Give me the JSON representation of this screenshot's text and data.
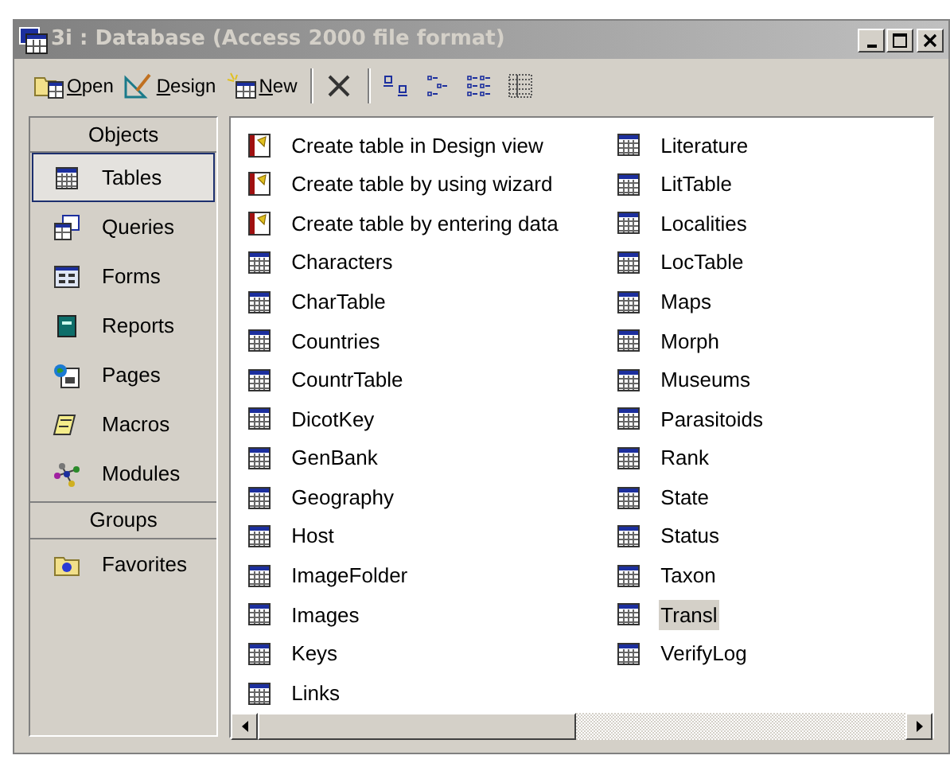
{
  "window": {
    "title": "3i : Database (Access 2000 file format)"
  },
  "toolbar": {
    "buttons": [
      {
        "label": "Open",
        "kind": "open"
      },
      {
        "label": "Design",
        "kind": "design"
      },
      {
        "label": "New",
        "kind": "new"
      }
    ],
    "tools": [
      {
        "kind": "delete"
      },
      {
        "kind": "large"
      },
      {
        "kind": "small"
      },
      {
        "kind": "list"
      },
      {
        "kind": "details"
      }
    ]
  },
  "sidebar": {
    "objects_header": "Objects",
    "items": [
      {
        "label": "Tables",
        "kind": "tables",
        "selected": true
      },
      {
        "label": "Queries",
        "kind": "queries",
        "selected": false
      },
      {
        "label": "Forms",
        "kind": "forms",
        "selected": false
      },
      {
        "label": "Reports",
        "kind": "reports",
        "selected": false
      },
      {
        "label": "Pages",
        "kind": "pages",
        "selected": false
      },
      {
        "label": "Macros",
        "kind": "macros",
        "selected": false
      },
      {
        "label": "Modules",
        "kind": "modules",
        "selected": false
      }
    ],
    "groups_header": "Groups",
    "groups": [
      {
        "label": "Favorites",
        "selected": false
      }
    ]
  },
  "list": {
    "columns": [
      [
        {
          "label": "Create table in Design view",
          "kind": "wizard",
          "selected": false
        },
        {
          "label": "Create table by using wizard",
          "kind": "wizard",
          "selected": false
        },
        {
          "label": "Create table by entering data",
          "kind": "wizard",
          "selected": false
        },
        {
          "label": "Characters",
          "kind": "table",
          "selected": false
        },
        {
          "label": "CharTable",
          "kind": "table",
          "selected": false
        },
        {
          "label": "Countries",
          "kind": "table",
          "selected": false
        },
        {
          "label": "CountrTable",
          "kind": "table",
          "selected": false
        },
        {
          "label": "DicotKey",
          "kind": "table",
          "selected": false
        },
        {
          "label": "GenBank",
          "kind": "table",
          "selected": false
        },
        {
          "label": "Geography",
          "kind": "table",
          "selected": false
        },
        {
          "label": "Host",
          "kind": "table",
          "selected": false
        },
        {
          "label": "ImageFolder",
          "kind": "table",
          "selected": false
        },
        {
          "label": "Images",
          "kind": "table",
          "selected": false
        },
        {
          "label": "Keys",
          "kind": "table",
          "selected": false
        },
        {
          "label": "Links",
          "kind": "table",
          "selected": false
        }
      ],
      [
        {
          "label": "Literature",
          "kind": "table",
          "selected": false
        },
        {
          "label": "LitTable",
          "kind": "table",
          "selected": false
        },
        {
          "label": "Localities",
          "kind": "table",
          "selected": false
        },
        {
          "label": "LocTable",
          "kind": "table",
          "selected": false
        },
        {
          "label": "Maps",
          "kind": "table",
          "selected": false
        },
        {
          "label": "Morph",
          "kind": "table",
          "selected": false
        },
        {
          "label": "Museums",
          "kind": "table",
          "selected": false
        },
        {
          "label": "Parasitoids",
          "kind": "table",
          "selected": false
        },
        {
          "label": "Rank",
          "kind": "table",
          "selected": false
        },
        {
          "label": "State",
          "kind": "table",
          "selected": false
        },
        {
          "label": "Status",
          "kind": "table",
          "selected": false
        },
        {
          "label": "Taxon",
          "kind": "table",
          "selected": false
        },
        {
          "label": "Transl",
          "kind": "table",
          "selected": true
        },
        {
          "label": "VerifyLog",
          "kind": "table",
          "selected": false
        }
      ]
    ]
  }
}
